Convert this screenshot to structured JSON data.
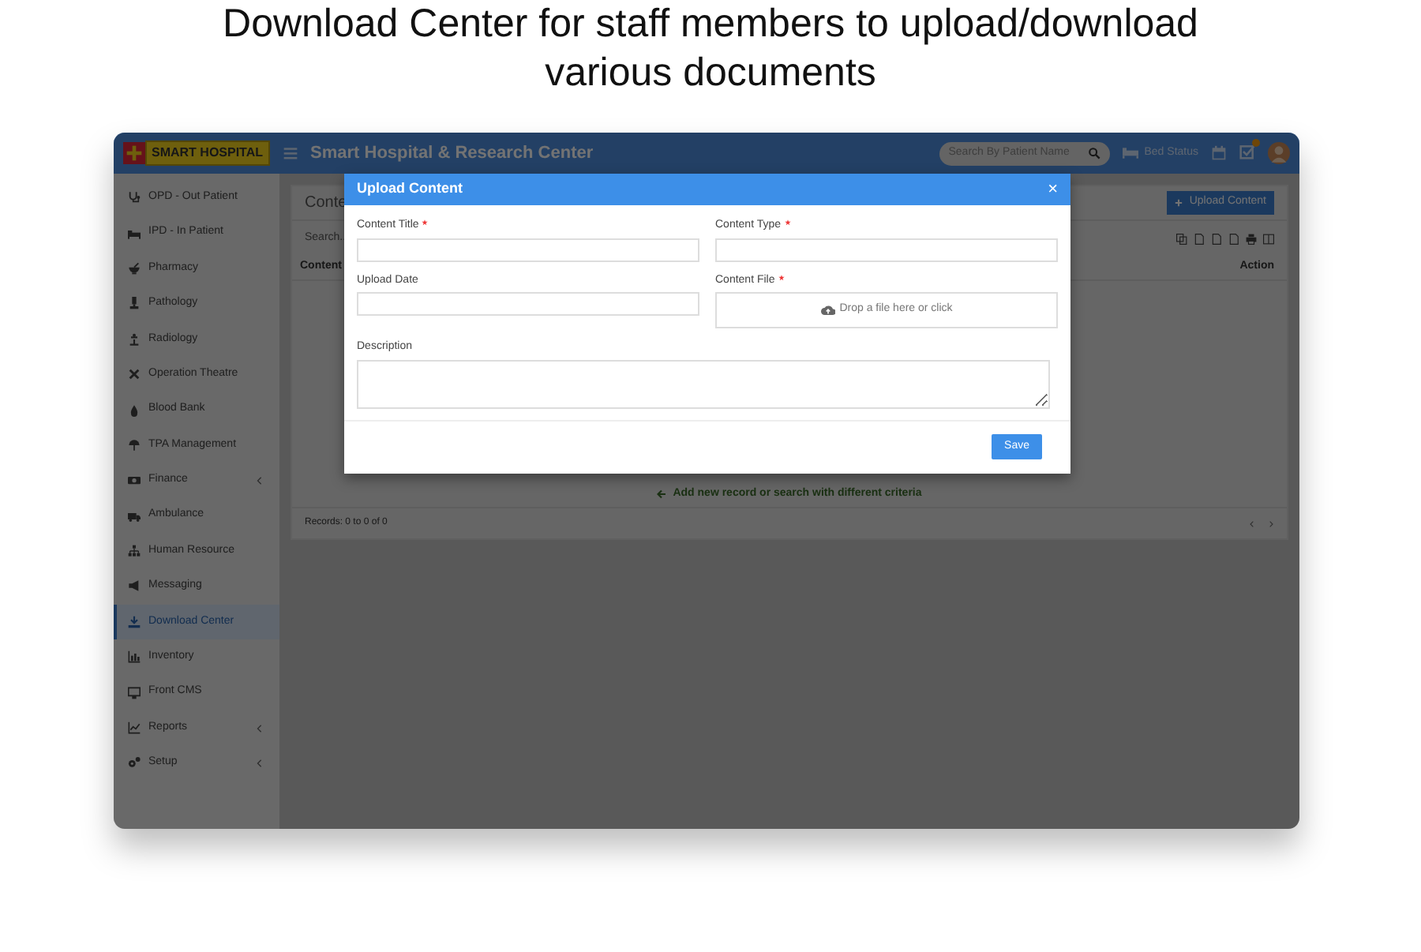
{
  "headline": "Download Center for staff members to upload/download various documents",
  "header": {
    "logo_text": "SMART HOSPITAL",
    "title": "Smart Hospital & Research Center",
    "search": {
      "placeholder": "Search By Patient Name"
    },
    "bed_status": "Bed Status"
  },
  "sidebar": {
    "items": [
      {
        "label": "OPD - Out Patient",
        "selected": false,
        "expandable": false
      },
      {
        "label": "IPD - In Patient",
        "selected": false,
        "expandable": false
      },
      {
        "label": "Pharmacy",
        "selected": false,
        "expandable": false
      },
      {
        "label": "Pathology",
        "selected": false,
        "expandable": false
      },
      {
        "label": "Radiology",
        "selected": false,
        "expandable": false
      },
      {
        "label": "Operation Theatre",
        "selected": false,
        "expandable": false
      },
      {
        "label": "Blood Bank",
        "selected": false,
        "expandable": false
      },
      {
        "label": "TPA Management",
        "selected": false,
        "expandable": false
      },
      {
        "label": "Finance",
        "selected": false,
        "expandable": true
      },
      {
        "label": "Ambulance",
        "selected": false,
        "expandable": false
      },
      {
        "label": "Human Resource",
        "selected": false,
        "expandable": false
      },
      {
        "label": "Messaging",
        "selected": false,
        "expandable": false
      },
      {
        "label": "Download Center",
        "selected": true,
        "expandable": false
      },
      {
        "label": "Inventory",
        "selected": false,
        "expandable": false
      },
      {
        "label": "Front CMS",
        "selected": false,
        "expandable": false
      },
      {
        "label": "Reports",
        "selected": false,
        "expandable": true
      },
      {
        "label": "Setup",
        "selected": false,
        "expandable": true
      }
    ]
  },
  "panel": {
    "title": "Conte",
    "upload_button": "Upload Content",
    "search": {
      "placeholder": "Search.."
    },
    "columns": [
      "Content",
      "Action"
    ],
    "empty_message": "Add new record or search with different criteria",
    "records": "Records: 0 to 0 of 0"
  },
  "modal": {
    "title": "Upload Content",
    "close": "×",
    "fields": [
      {
        "label": "Content Title",
        "required": true,
        "kind": "text"
      },
      {
        "label": "Content Type",
        "required": true,
        "kind": "text"
      },
      {
        "label": "Upload Date",
        "required": false,
        "kind": "text"
      },
      {
        "label": "Content File",
        "required": true,
        "kind": "file",
        "hint": "Drop a file here or click"
      },
      {
        "label": "Description",
        "required": false,
        "kind": "textarea"
      }
    ],
    "save_button": "Save"
  }
}
